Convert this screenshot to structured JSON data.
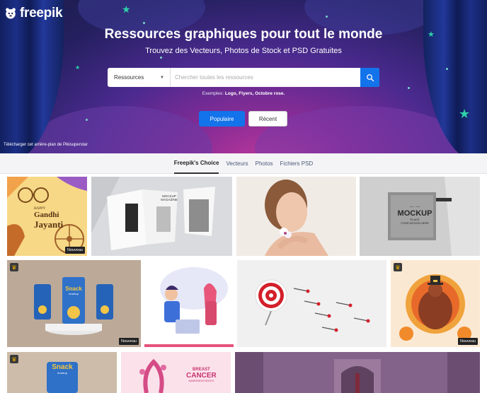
{
  "brand": {
    "name": "freepik"
  },
  "hero": {
    "title": "Ressources graphiques pour tout le monde",
    "subtitle": "Trouvez des Vecteurs, Photos de Stock et PSD Gratuites",
    "search": {
      "category": "Ressources",
      "placeholder": "Chercher toutes les ressources",
      "value": ""
    },
    "examples_label": "Exemples:",
    "examples_values": "Logo, Flyers, Octobre rose.",
    "buttons": {
      "popular": "Populaire",
      "recent": "Récent"
    },
    "credit": "Télécharger cet arrière-plan de Pikisuperstar"
  },
  "tabs": [
    {
      "label": "Freepik's Choice",
      "active": true
    },
    {
      "label": "Vecteurs",
      "active": false
    },
    {
      "label": "Photos",
      "active": false
    },
    {
      "label": "Fichiers PSD",
      "active": false
    }
  ],
  "tiles": {
    "gandhi": {
      "line1": "HAPPY",
      "line2": "Gandhi",
      "line3": "Jayanti",
      "badge": "Nouveau"
    },
    "magazine": {
      "text": "MOCKUP MAGAZINE"
    },
    "sign": {
      "line1": "MOCKUP",
      "line2": "PLACE",
      "line3": "YOUR DESIGN HERE"
    },
    "snack": {
      "brand": "Snack",
      "sub": "mockup",
      "badge": "Nouveau"
    },
    "turkey": {
      "badge": "Nouveau"
    },
    "snack2": {
      "brand": "Snack",
      "sub": "mockup"
    },
    "breast": {
      "line1": "BREAST",
      "line2": "CANCER",
      "line3": "AWARENESS MONTH"
    }
  },
  "colors": {
    "accent": "#1273eb",
    "star": "#2fd1a9",
    "premium": "#f5b301"
  },
  "icons": [
    "freepik-logo-icon",
    "search-icon",
    "chevron-down-icon",
    "crown-icon"
  ]
}
